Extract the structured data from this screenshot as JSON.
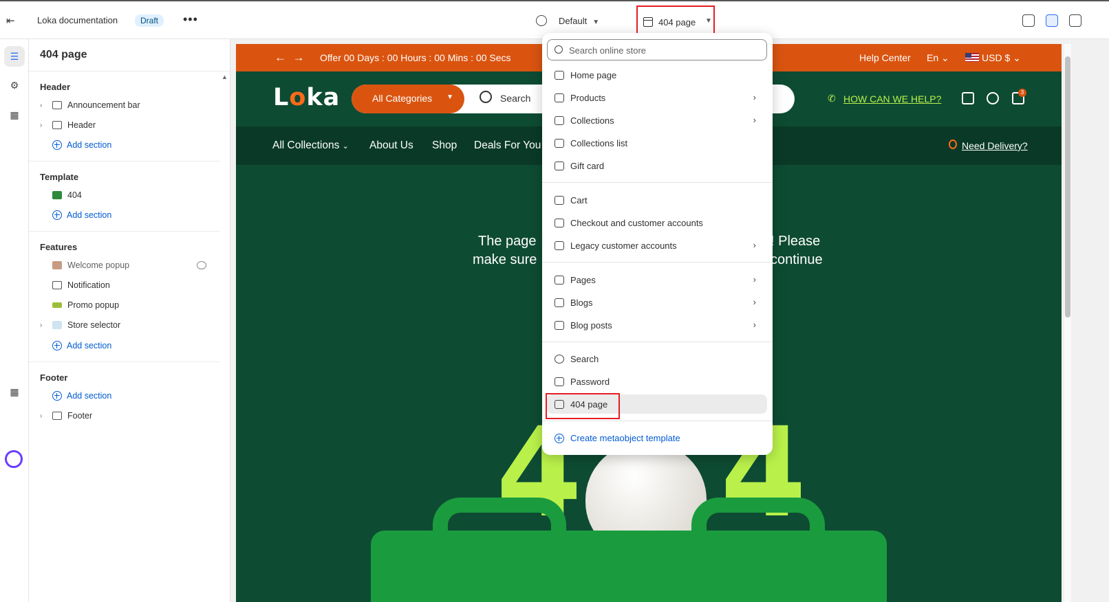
{
  "topbar": {
    "doc_title": "Loka documentation",
    "badge": "Draft",
    "more": "•••",
    "theme": "Default",
    "page": "404 page"
  },
  "sidebar": {
    "title": "404 page",
    "groups": {
      "header": {
        "title": "Header",
        "items": [
          "Announcement bar",
          "Header"
        ],
        "add": "Add section"
      },
      "template": {
        "title": "Template",
        "items": [
          "404"
        ],
        "add": "Add section"
      },
      "features": {
        "title": "Features",
        "items": [
          "Welcome popup",
          "Notification",
          "Promo popup",
          "Store selector"
        ],
        "add": "Add section"
      },
      "footer": {
        "title": "Footer",
        "add": "Add section",
        "items": [
          "Footer"
        ]
      }
    }
  },
  "preview": {
    "announcement": {
      "offer": "Offer 00 Days : 00 Hours : 00 Mins : 00 Secs",
      "help": "Help Center",
      "lang": "En",
      "currency": "USD $"
    },
    "header": {
      "logo": "Loka",
      "categories": "All Categories",
      "search_placeholder": "Search",
      "help_link": "HOW CAN WE HELP?",
      "cart_count": "3"
    },
    "nav": {
      "items": [
        "All Collections",
        "About Us",
        "Shop",
        "Deals For You"
      ],
      "delivery": "Need Delivery?"
    },
    "message_left_1": "The page",
    "message_left_2": "make sure",
    "message_right_1": "! Please",
    "message_right_2": "continue",
    "big_left": "4",
    "big_right": "4"
  },
  "dropdown": {
    "search_placeholder": "Search online store",
    "items": [
      {
        "label": "Home page",
        "submenu": false
      },
      {
        "label": "Products",
        "submenu": true
      },
      {
        "label": "Collections",
        "submenu": true
      },
      {
        "label": "Collections list",
        "submenu": false
      },
      {
        "label": "Gift card",
        "submenu": false
      },
      {
        "label": "Cart",
        "submenu": false
      },
      {
        "label": "Checkout and customer accounts",
        "submenu": false
      },
      {
        "label": "Legacy customer accounts",
        "submenu": true
      },
      {
        "label": "Pages",
        "submenu": true
      },
      {
        "label": "Blogs",
        "submenu": true
      },
      {
        "label": "Blog posts",
        "submenu": true
      },
      {
        "label": "Search",
        "submenu": false
      },
      {
        "label": "Password",
        "submenu": false
      },
      {
        "label": "404 page",
        "submenu": false,
        "selected": true
      }
    ],
    "create": "Create metaobject template"
  },
  "colors": {
    "accent_orange": "#da5410",
    "dark_green": "#0e4b33",
    "lime": "#b9f14a",
    "link_blue": "#005bd3",
    "highlight_red": "#e51c23"
  }
}
